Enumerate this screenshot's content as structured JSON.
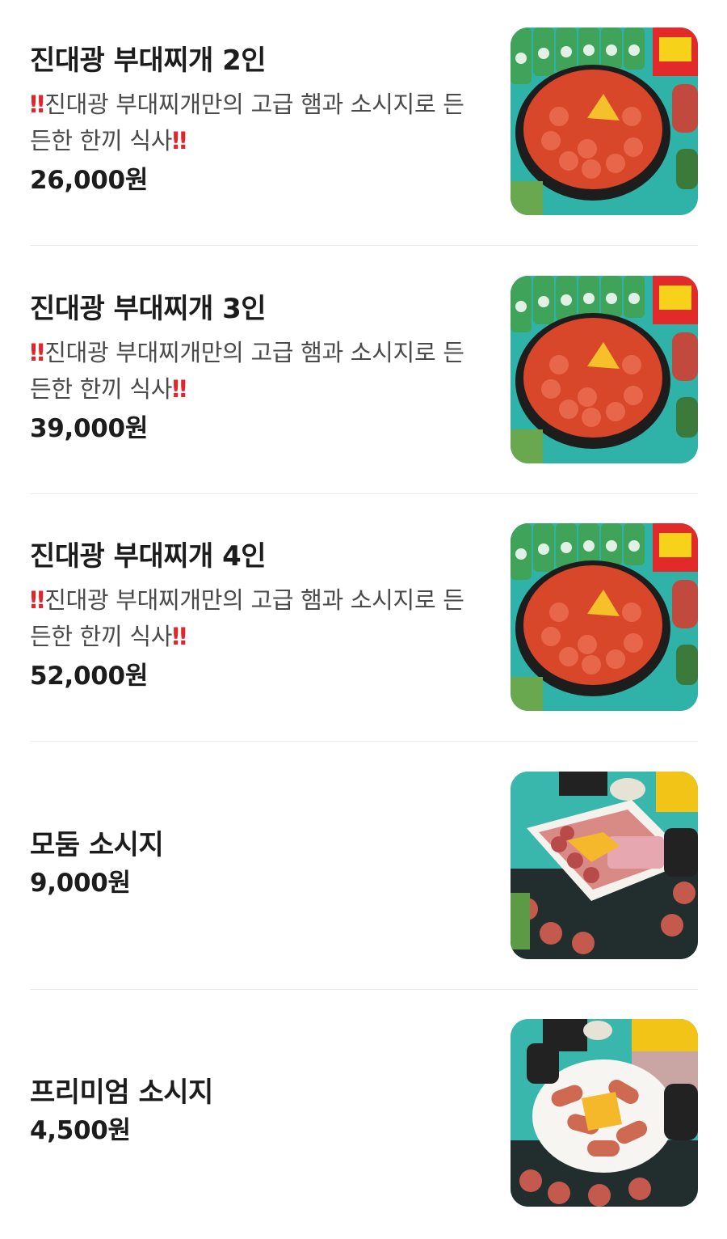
{
  "menu": {
    "items": [
      {
        "name": "진대광 부대찌개 2인",
        "desc_prefix": "‼",
        "desc": "진대광 부대찌개만의 고급 햄과 소시지로 든든한 한끼 식사",
        "desc_suffix": "‼",
        "price": "26,000원",
        "image": "budae-jjigae-photo"
      },
      {
        "name": "진대광 부대찌개 3인",
        "desc_prefix": "‼",
        "desc": "진대광 부대찌개만의 고급 햄과 소시지로 든든한 한끼 식사",
        "desc_suffix": "‼",
        "price": "39,000원",
        "image": "budae-jjigae-photo"
      },
      {
        "name": "진대광 부대찌개 4인",
        "desc_prefix": "‼",
        "desc": "진대광 부대찌개만의 고급 햄과 소시지로 든든한 한끼 식사",
        "desc_suffix": "‼",
        "price": "52,000원",
        "image": "budae-jjigae-photo"
      },
      {
        "name": "모둠 소시지",
        "price": "9,000원",
        "image": "sausage-platter-photo"
      },
      {
        "name": "프리미엄 소시지",
        "price": "4,500원",
        "image": "premium-sausage-photo"
      }
    ]
  },
  "colors": {
    "accent_red": "#e0262b",
    "teal_background": "#2fb3a8",
    "divider": "#ececec"
  }
}
